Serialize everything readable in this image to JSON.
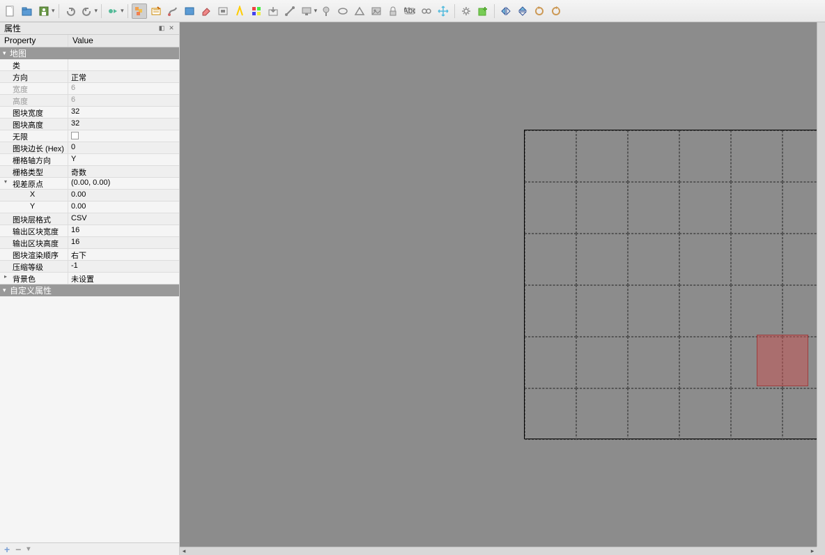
{
  "toolbar": {
    "icons": [
      "new-doc",
      "open-doc",
      "save-doc",
      "undo",
      "redo",
      "run",
      "layers",
      "edit-rect",
      "paint",
      "mask",
      "eraser",
      "fit",
      "highlight",
      "color-select",
      "import",
      "edit-path",
      "screen",
      "pin",
      "ellipse",
      "triangle",
      "image",
      "lock",
      "text",
      "link",
      "move",
      "gear",
      "layer-add",
      "flip-h",
      "flip-v",
      "rotate-ccw",
      "rotate-cw"
    ]
  },
  "panel": {
    "title": "属性",
    "header_a": "Property",
    "header_b": "Value",
    "section_map": "地图",
    "section_custom": "自定义属性",
    "rows": [
      {
        "p": "类",
        "v": ""
      },
      {
        "p": "方向",
        "v": "正常"
      },
      {
        "p": "宽度",
        "v": "6",
        "disabled": true
      },
      {
        "p": "高度",
        "v": "6",
        "disabled": true
      },
      {
        "p": "图块宽度",
        "v": "32"
      },
      {
        "p": "图块高度",
        "v": "32"
      },
      {
        "p": "无限",
        "v": "[checkbox]"
      },
      {
        "p": "图块边长 (Hex)",
        "v": "0"
      },
      {
        "p": "栅格轴方向",
        "v": "Y"
      },
      {
        "p": "栅格类型",
        "v": "奇数"
      },
      {
        "p": "视差原点",
        "v": "(0.00, 0.00)",
        "expand": true
      },
      {
        "p": "X",
        "v": "0.00",
        "sub": true
      },
      {
        "p": "Y",
        "v": "0.00",
        "sub": true
      },
      {
        "p": "图块层格式",
        "v": "CSV"
      },
      {
        "p": "输出区块宽度",
        "v": "16"
      },
      {
        "p": "输出区块高度",
        "v": "16"
      },
      {
        "p": "图块渲染顺序",
        "v": "右下"
      },
      {
        "p": "压缩等级",
        "v": "-1"
      },
      {
        "p": "背景色",
        "v": "未设置",
        "expand": false,
        "has_arrow": true
      }
    ]
  },
  "mapgrid": {
    "cols": 6,
    "rows": 6
  }
}
